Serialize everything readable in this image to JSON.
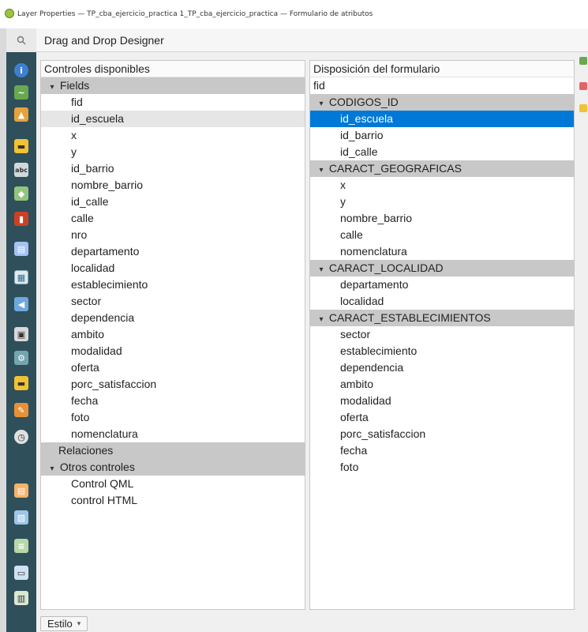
{
  "window": {
    "title": "Layer Properties — TP_cba_ejercicio_practica 1_TP_cba_ejercicio_practica — Formulario de atributos"
  },
  "header": {
    "title": "Drag and Drop Designer"
  },
  "left_panel": {
    "heading": "Controles disponibles",
    "groups": [
      {
        "label": "Fields",
        "items": [
          "fid",
          "id_escuela",
          "x",
          "y",
          "id_barrio",
          "nombre_barrio",
          "id_calle",
          "calle",
          "nro",
          "departamento",
          "localidad",
          "establecimiento",
          "sector",
          "dependencia",
          "ambito",
          "modalidad",
          "oferta",
          "porc_satisfaccion",
          "fecha",
          "foto",
          "nomenclatura"
        ]
      },
      {
        "label": "Relaciones",
        "items": []
      },
      {
        "label": "Otros controles",
        "items": [
          "Control QML",
          "control HTML"
        ]
      }
    ]
  },
  "right_panel": {
    "heading": "Disposición del formulario",
    "top_field": "fid",
    "groups": [
      {
        "label": "CODIGOS_ID",
        "items": [
          "id_escuela",
          "id_barrio",
          "id_calle"
        ]
      },
      {
        "label": "CARACT_GEOGRAFICAS",
        "items": [
          "x",
          "y",
          "nombre_barrio",
          "calle",
          "nomenclatura"
        ]
      },
      {
        "label": "CARACT_LOCALIDAD",
        "items": [
          "departamento",
          "localidad"
        ]
      },
      {
        "label": "CARACT_ESTABLECIMIENTOS",
        "items": [
          "sector",
          "establecimiento",
          "dependencia",
          "ambito",
          "modalidad",
          "oferta",
          "porc_satisfaccion",
          "fecha",
          "foto"
        ]
      }
    ]
  },
  "footer": {
    "style_label": "Estilo"
  },
  "colors": {
    "selection": "#0078d7",
    "group_bg": "#c8c8c8",
    "sidebar_bg": "#2f4f5a"
  },
  "sidebar_icons": [
    "search-icon",
    "information-icon",
    "source-icon",
    "symbology-icon",
    "labels-icon",
    "masks-icon",
    "3d-view-icon",
    "diagrams-icon",
    "fields-icon",
    "attributes-form-icon",
    "joins-icon",
    "auxiliary-storage-icon",
    "actions-icon",
    "display-icon",
    "rendering-icon",
    "temporal-icon",
    "variables-icon",
    "metadata-icon",
    "dependencies-icon",
    "legend-icon",
    "server-icon"
  ]
}
